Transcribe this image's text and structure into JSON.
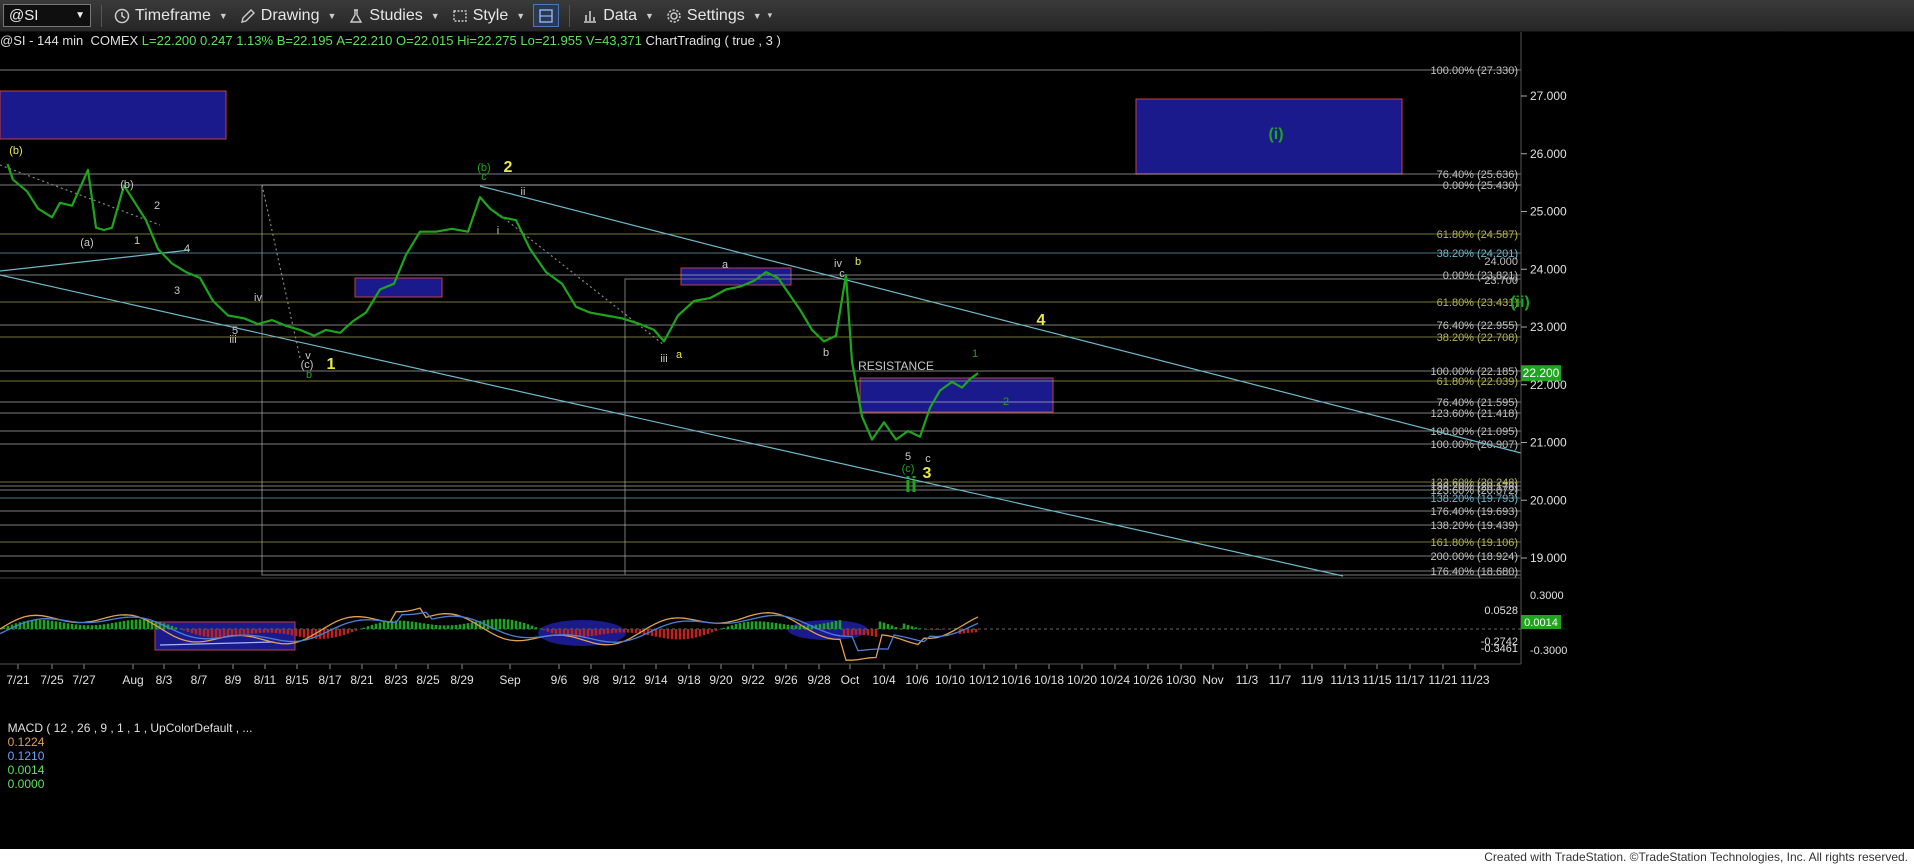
{
  "toolbar": {
    "symbol": "@SI",
    "timeframe": "Timeframe",
    "drawing": "Drawing",
    "studies": "Studies",
    "style": "Style",
    "data": "Data",
    "settings": "Settings"
  },
  "status": {
    "head": "@SI - 144 min  COMEX ",
    "L": "L=22.200",
    "chg": "0.247",
    "pct": "1.13%",
    "B": "B=22.195",
    "A": "A=22.210",
    "O": "O=22.015",
    "Hi": "Hi=22.275",
    "Lo": "Lo=21.955",
    "V": "V=43,371",
    "tail": "ChartTrading ( true , 3 )"
  },
  "macd": {
    "label": "MACD ( 12 , 26 , 9 , 1 , 1 , UpColorDefault , ... ",
    "v1": "0.1224",
    "v2": "0.1210",
    "v3": "0.0014",
    "v4": "0.0000"
  },
  "footer": "Created with TradeStation. ©TradeStation Technologies, Inc. All rights reserved.",
  "colors": {
    "price": "#1ea51e",
    "box": "#1a1a8c",
    "trend": "#6fb7c9",
    "fib": "#b0b0b0",
    "yellow": "#e8e84a",
    "macd_line": "#4b7fd6",
    "signal_line": "#e0a050"
  },
  "chart_data": {
    "type": "line",
    "title": "@SI - 144 min COMEX",
    "ylim": [
      18.6,
      27.6
    ],
    "y_ticks": [
      "27.000",
      "26.000",
      "25.000",
      "24.000",
      "23.000",
      "22.000",
      "21.000",
      "20.000",
      "19.000"
    ],
    "current_price": "22.200",
    "x_ticks": [
      "7/21",
      "7/25",
      "7/27",
      "Aug",
      "8/3",
      "8/7",
      "8/9",
      "8/11",
      "8/15",
      "8/17",
      "8/21",
      "8/23",
      "8/25",
      "8/29",
      "Sep",
      "9/6",
      "9/8",
      "9/12",
      "9/14",
      "9/18",
      "9/20",
      "9/22",
      "9/26",
      "9/28",
      "Oct",
      "10/4",
      "10/6",
      "10/10",
      "10/12",
      "10/16",
      "10/18",
      "10/20",
      "10/24",
      "10/26",
      "10/30",
      "Nov",
      "11/3",
      "11/7",
      "11/9",
      "11/13",
      "11/15",
      "11/17",
      "11/21",
      "11/23"
    ],
    "series": [
      {
        "points": [
          [
            7.5,
            25.82
          ],
          [
            13,
            25.55
          ],
          [
            27,
            25.35
          ],
          [
            38,
            25.05
          ],
          [
            52,
            24.9
          ],
          [
            60,
            25.15
          ],
          [
            72,
            25.1
          ],
          [
            88,
            25.72
          ],
          [
            96,
            24.72
          ],
          [
            104,
            24.68
          ],
          [
            112,
            24.72
          ],
          [
            124,
            25.45
          ],
          [
            135,
            25.15
          ],
          [
            146,
            24.85
          ],
          [
            158,
            24.35
          ],
          [
            172,
            24.1
          ],
          [
            186,
            23.95
          ],
          [
            200,
            23.85
          ],
          [
            213,
            23.45
          ],
          [
            228,
            23.2
          ],
          [
            244,
            23.15
          ],
          [
            258,
            23.05
          ],
          [
            272,
            23.12
          ],
          [
            286,
            23.02
          ],
          [
            300,
            22.95
          ],
          [
            314,
            22.85
          ],
          [
            326,
            22.95
          ],
          [
            340,
            22.9
          ],
          [
            353,
            23.1
          ],
          [
            366,
            23.25
          ],
          [
            380,
            23.65
          ],
          [
            394,
            23.75
          ],
          [
            406,
            24.25
          ],
          [
            420,
            24.65
          ],
          [
            436,
            24.65
          ],
          [
            452,
            24.7
          ],
          [
            468,
            24.65
          ],
          [
            480,
            25.25
          ],
          [
            490,
            25.05
          ],
          [
            502,
            24.9
          ],
          [
            516,
            24.85
          ],
          [
            530,
            24.35
          ],
          [
            546,
            23.95
          ],
          [
            562,
            23.75
          ],
          [
            576,
            23.35
          ],
          [
            590,
            23.25
          ],
          [
            606,
            23.2
          ],
          [
            622,
            23.15
          ],
          [
            640,
            23.05
          ],
          [
            654,
            22.95
          ],
          [
            664,
            22.75
          ],
          [
            678,
            23.2
          ],
          [
            694,
            23.45
          ],
          [
            710,
            23.5
          ],
          [
            726,
            23.65
          ],
          [
            740,
            23.7
          ],
          [
            754,
            23.8
          ],
          [
            766,
            23.95
          ],
          [
            778,
            23.85
          ],
          [
            790,
            23.55
          ],
          [
            800,
            23.3
          ],
          [
            812,
            22.95
          ],
          [
            824,
            22.75
          ],
          [
            836,
            22.85
          ],
          [
            846,
            23.9
          ],
          [
            852,
            22.4
          ],
          [
            862,
            21.45
          ],
          [
            872,
            21.05
          ],
          [
            884,
            21.35
          ],
          [
            896,
            21.05
          ],
          [
            908,
            21.2
          ],
          [
            920,
            21.1
          ],
          [
            930,
            21.6
          ],
          [
            940,
            21.9
          ],
          [
            952,
            22.05
          ],
          [
            962,
            21.95
          ],
          [
            970,
            22.1
          ],
          [
            978,
            22.2
          ]
        ]
      }
    ],
    "fib_levels": [
      {
        "label": "100.00% (27.330)",
        "color": "#c0c0c0"
      },
      {
        "label": "76.40% (25.636)",
        "color": "#c0c0c0"
      },
      {
        "label": "0.00% (25.430)",
        "color": "#c0c0c0"
      },
      {
        "label": "61.80% (24.587)",
        "color": "#b5b555"
      },
      {
        "label": "38.20% (24.201)",
        "color": "#6fb7c9"
      },
      {
        "label": "0.00% (23.821)",
        "color": "#c0c0c0"
      },
      {
        "label": "61.80% (23.431)",
        "color": "#b5b555"
      },
      {
        "label": "76.40% (22.955)",
        "color": "#c0c0c0"
      },
      {
        "label": "38.20% (22.708)",
        "color": "#b5b555"
      },
      {
        "label": "100.00% (22.185)",
        "color": "#c0c0c0"
      },
      {
        "label": "61.80% (22.039)",
        "color": "#b5b555"
      },
      {
        "label": "76.40% (21.595)",
        "color": "#c0c0c0"
      },
      {
        "label": "123.60% (21.418)",
        "color": "#c0c0c0"
      },
      {
        "label": "100.00% (21.095)",
        "color": "#c0c0c0"
      },
      {
        "label": "100.00% (20.907)",
        "color": "#c0c0c0"
      },
      {
        "label": "123.60% (20.248)",
        "color": "#b5b555"
      },
      {
        "label": "138.20% (20.178)",
        "color": "#c0c0c0"
      },
      {
        "label": "123.60% (20.072)",
        "color": "#c0c0c0"
      },
      {
        "label": "138.20% (19.793)",
        "color": "#6fb7c9"
      },
      {
        "label": "176.40% (19.693)",
        "color": "#c0c0c0"
      },
      {
        "label": "138.20% (19.439)",
        "color": "#c0c0c0"
      },
      {
        "label": "161.80% (19.106)",
        "color": "#b5b555"
      },
      {
        "label": "200.00% (18.924)",
        "color": "#c0c0c0"
      },
      {
        "label": "176.40% (18.680)",
        "color": "#c0c0c0"
      }
    ],
    "right_labels": [
      "24.000",
      "23.700"
    ],
    "wave_labels": [
      {
        "text": "(b)",
        "color": "#e8e84a"
      },
      {
        "text": "(b)",
        "color": "#c8c8c8"
      },
      {
        "text": "(a)",
        "color": "#c8c8c8"
      },
      {
        "text": "2",
        "color": "#c8c8c8"
      },
      {
        "text": "1",
        "color": "#c8c8c8"
      },
      {
        "text": "4",
        "color": "#c8c8c8"
      },
      {
        "text": "3",
        "color": "#c8c8c8"
      },
      {
        "text": "5",
        "color": "#c8c8c8"
      },
      {
        "text": "iii",
        "color": "#c8c8c8"
      },
      {
        "text": "iv",
        "color": "#c8c8c8"
      },
      {
        "text": "v",
        "color": "#c8c8c8"
      },
      {
        "text": "(c)",
        "color": "#c8c8c8"
      },
      {
        "text": "b",
        "color": "#1ea51e"
      },
      {
        "text": "1",
        "color": "#e8e84a"
      },
      {
        "text": "(b)",
        "color": "#1ea51e"
      },
      {
        "text": "c",
        "color": "#1ea51e"
      },
      {
        "text": "2",
        "color": "#e8e84a"
      },
      {
        "text": "i",
        "color": "#c8c8c8"
      },
      {
        "text": "ii",
        "color": "#c8c8c8"
      },
      {
        "text": "iii",
        "color": "#c8c8c8"
      },
      {
        "text": "a",
        "color": "#e8e84a"
      },
      {
        "text": "a",
        "color": "#c8c8c8"
      },
      {
        "text": "b",
        "color": "#c8c8c8"
      },
      {
        "text": "iv",
        "color": "#c8c8c8"
      },
      {
        "text": "c",
        "color": "#c8c8c8"
      },
      {
        "text": "b",
        "color": "#e8e84a"
      },
      {
        "text": "RESISTANCE",
        "color": "#c8c8c8"
      },
      {
        "text": "1",
        "color": "#1ea51e"
      },
      {
        "text": "2",
        "color": "#1ea51e"
      },
      {
        "text": "5",
        "color": "#c8c8c8"
      },
      {
        "text": "c",
        "color": "#c8c8c8"
      },
      {
        "text": "(c)",
        "color": "#1ea51e"
      },
      {
        "text": "3",
        "color": "#e8e84a"
      },
      {
        "text": "ii",
        "color": "#1ea51e"
      },
      {
        "text": "4",
        "color": "#e8e84a"
      },
      {
        "text": "(i)",
        "color": "#1ea51e"
      },
      {
        "text": "(ii)",
        "color": "#1ea51e"
      }
    ],
    "macd_ylim": [
      -0.36,
      0.36
    ],
    "macd_ticks": [
      "0.3000",
      "0.0528",
      "0.0014",
      "-0.2742",
      "-0.3461",
      "-0.3000"
    ]
  }
}
